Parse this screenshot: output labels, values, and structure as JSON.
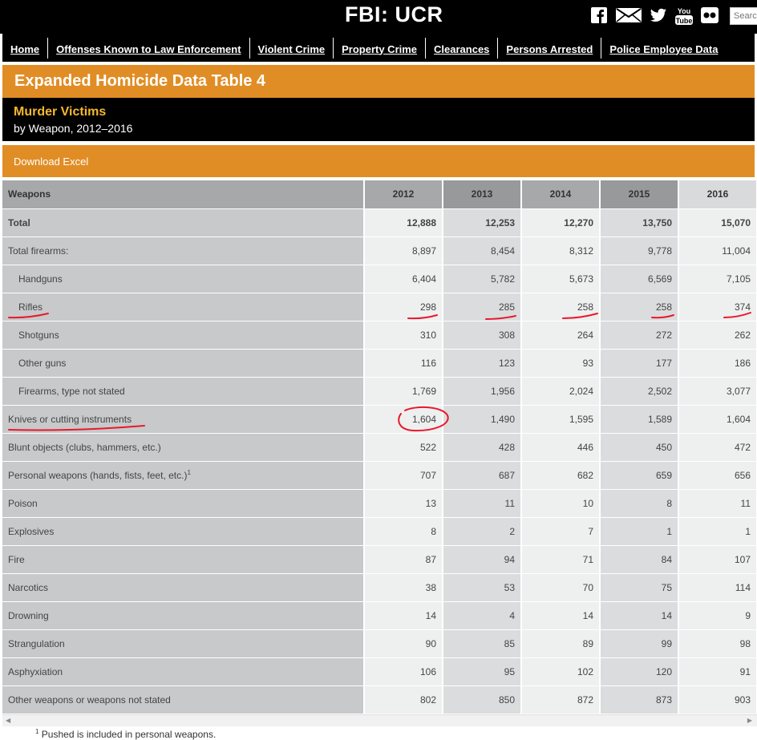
{
  "header": {
    "site_title": "FBI: UCR",
    "social_icons": [
      "facebook-icon",
      "email-icon",
      "twitter-icon",
      "youtube-icon",
      "flickr-icon"
    ],
    "youtube_top": "You",
    "youtube_bottom": "Tube",
    "search_placeholder": "Search"
  },
  "nav": [
    "Home",
    "Offenses Known to Law Enforcement",
    "Violent Crime",
    "Property Crime",
    "Clearances",
    "Persons Arrested",
    "Police Employee Data"
  ],
  "page": {
    "title": "Expanded Homicide Data Table 4",
    "subtitle": "Murder Victims",
    "subsubtitle": "by Weapon, 2012–2016",
    "download_label": "Download Excel"
  },
  "table": {
    "headers": [
      "Weapons",
      "2012",
      "2013",
      "2014",
      "2015",
      "2016"
    ],
    "rows": [
      {
        "label": "Total",
        "values": [
          "12,888",
          "12,253",
          "12,270",
          "13,750",
          "15,070"
        ]
      },
      {
        "label": "Total firearms:",
        "values": [
          "8,897",
          "8,454",
          "8,312",
          "9,778",
          "11,004"
        ]
      },
      {
        "label": "Handguns",
        "values": [
          "6,404",
          "5,782",
          "5,673",
          "6,569",
          "7,105"
        ]
      },
      {
        "label": "Rifles",
        "values": [
          "298",
          "285",
          "258",
          "258",
          "374"
        ]
      },
      {
        "label": "Shotguns",
        "values": [
          "310",
          "308",
          "264",
          "272",
          "262"
        ]
      },
      {
        "label": "Other guns",
        "values": [
          "116",
          "123",
          "93",
          "177",
          "186"
        ]
      },
      {
        "label": "Firearms, type not stated",
        "values": [
          "1,769",
          "1,956",
          "2,024",
          "2,502",
          "3,077"
        ]
      },
      {
        "label": "Knives or cutting instruments",
        "values": [
          "1,604",
          "1,490",
          "1,595",
          "1,589",
          "1,604"
        ]
      },
      {
        "label": "Blunt objects (clubs, hammers, etc.)",
        "values": [
          "522",
          "428",
          "446",
          "450",
          "472"
        ]
      },
      {
        "label": "Personal weapons (hands, fists, feet, etc.)",
        "footnote_mark": "1",
        "values": [
          "707",
          "687",
          "682",
          "659",
          "656"
        ]
      },
      {
        "label": "Poison",
        "values": [
          "13",
          "11",
          "10",
          "8",
          "11"
        ]
      },
      {
        "label": "Explosives",
        "values": [
          "8",
          "2",
          "7",
          "1",
          "1"
        ]
      },
      {
        "label": "Fire",
        "values": [
          "87",
          "94",
          "71",
          "84",
          "107"
        ]
      },
      {
        "label": "Narcotics",
        "values": [
          "38",
          "53",
          "70",
          "75",
          "114"
        ]
      },
      {
        "label": "Drowning",
        "values": [
          "14",
          "4",
          "14",
          "14",
          "9"
        ]
      },
      {
        "label": "Strangulation",
        "values": [
          "90",
          "85",
          "89",
          "99",
          "98"
        ]
      },
      {
        "label": "Asphyxiation",
        "values": [
          "106",
          "95",
          "102",
          "120",
          "91"
        ]
      },
      {
        "label": "Other weapons or weapons not stated",
        "values": [
          "802",
          "850",
          "872",
          "873",
          "903"
        ]
      }
    ]
  },
  "footnote": {
    "mark": "1",
    "text": "Pushed is included in personal weapons."
  },
  "colors": {
    "header_bg": "#000000",
    "orange": "#e18d25",
    "subtitle_yellow": "#f5b82e",
    "annotation_red": "#e8192c"
  }
}
